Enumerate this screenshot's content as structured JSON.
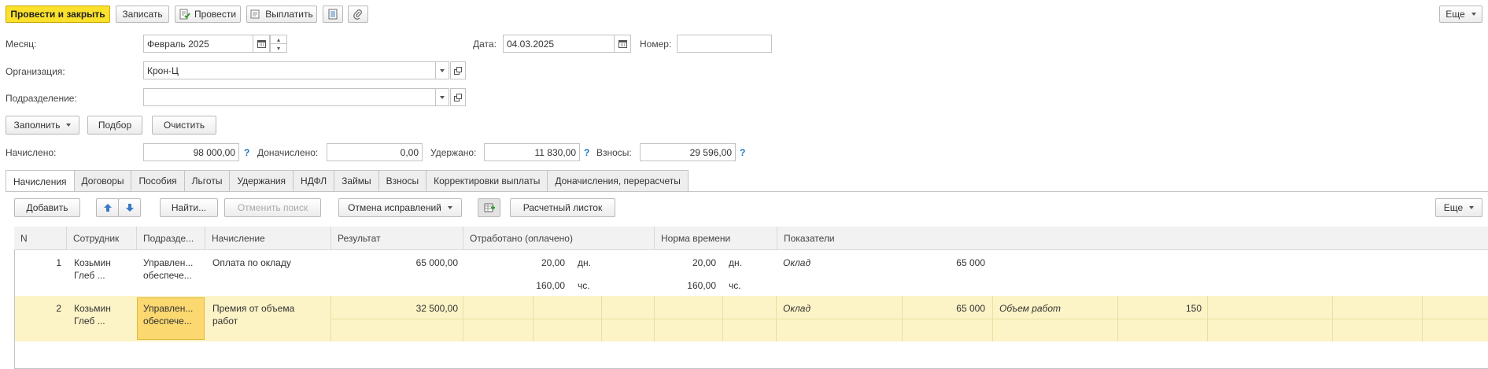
{
  "toolbar": {
    "post_close": "Провести и закрыть",
    "save": "Записать",
    "post": "Провести",
    "pay": "Выплатить",
    "more": "Еще"
  },
  "header": {
    "month_label": "Месяц:",
    "month_value": "Февраль 2025",
    "date_label": "Дата:",
    "date_value": "04.03.2025",
    "number_label": "Номер:",
    "number_value": "",
    "org_label": "Организация:",
    "org_value": "Крон-Ц",
    "dept_label": "Подразделение:",
    "dept_value": ""
  },
  "actions": {
    "fill": "Заполнить",
    "select": "Подбор",
    "clear": "Очистить"
  },
  "totals": {
    "accrued_label": "Начислено:",
    "accrued_value": "98 000,00",
    "additional_label": "Доначислено:",
    "additional_value": "0,00",
    "withheld_label": "Удержано:",
    "withheld_value": "11 830,00",
    "contrib_label": "Взносы:",
    "contrib_value": "29 596,00",
    "help": "?"
  },
  "tabs": [
    "Начисления",
    "Договоры",
    "Пособия",
    "Льготы",
    "Удержания",
    "НДФЛ",
    "Займы",
    "Взносы",
    "Корректировки выплаты",
    "Доначисления, перерасчеты"
  ],
  "table_toolbar": {
    "add": "Добавить",
    "find": "Найти...",
    "cancel_search": "Отменить поиск",
    "undo_fix": "Отмена исправлений",
    "payslip": "Расчетный листок",
    "more": "Еще"
  },
  "columns": [
    "N",
    "Сотрудник",
    "Подразде...",
    "Начисление",
    "Результат",
    "Отработано (оплачено)",
    "Норма времени",
    "Показатели"
  ],
  "rows": [
    {
      "n": "1",
      "employee": [
        "Козьмин",
        "Глеб ..."
      ],
      "dept": [
        "Управлен...",
        "обеспече..."
      ],
      "accrual": [
        "Оплата по окладу"
      ],
      "result": "65 000,00",
      "worked_days": "20,00",
      "worked_days_unit": "дн.",
      "worked_hours": "160,00",
      "worked_hours_unit": "чс.",
      "norm_days": "20,00",
      "norm_days_unit": "дн.",
      "norm_hours": "160,00",
      "norm_hours_unit": "чс.",
      "ind1_name": "Оклад",
      "ind1_value": "65 000",
      "ind2_name": "",
      "ind2_value": ""
    },
    {
      "n": "2",
      "employee": [
        "Козьмин",
        "Глеб ..."
      ],
      "dept": [
        "Управлен...",
        "обеспече..."
      ],
      "accrual": [
        "Премия от объема",
        "работ"
      ],
      "result": "32 500,00",
      "ind1_name": "Оклад",
      "ind1_value": "65 000",
      "ind2_name": "Объем работ",
      "ind2_value": "150"
    }
  ]
}
